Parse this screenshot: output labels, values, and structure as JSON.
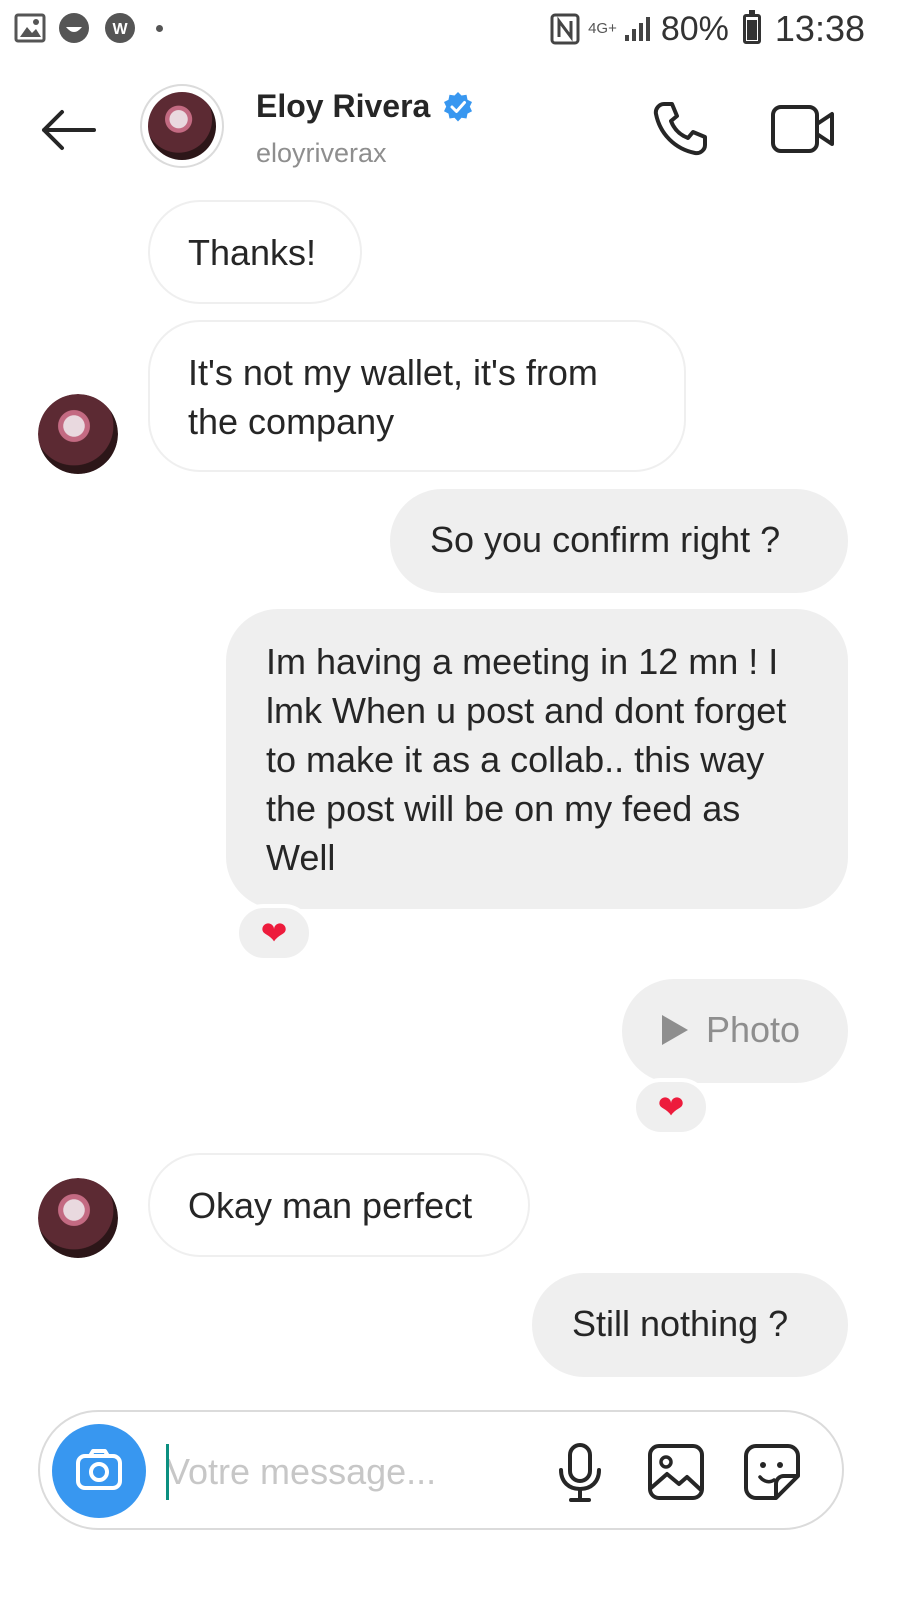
{
  "status_bar": {
    "left_icons": [
      "gallery-icon",
      "emoji-icon",
      "w-app-icon"
    ],
    "network": "4G+",
    "battery": "80%",
    "time": "13:38"
  },
  "header": {
    "name": "Eloy Rivera",
    "username": "eloyriverax",
    "verified": true
  },
  "messages": [
    {
      "direction": "in",
      "text": "Thanks!"
    },
    {
      "direction": "in",
      "text": "It's not my wallet, it's from the company"
    },
    {
      "direction": "out",
      "text": "So you confirm right ?"
    },
    {
      "direction": "out",
      "text": "Im having a meeting in 12 mn ! I lmk When u post and dont forget to make it as a collab.. this way the post will be on my feed as Well",
      "reaction": "❤"
    },
    {
      "direction": "out",
      "type": "photo",
      "text": "Photo",
      "reaction": "❤"
    },
    {
      "direction": "in",
      "text": "Okay man perfect"
    },
    {
      "direction": "out",
      "text": "Still nothing ?"
    }
  ],
  "composer": {
    "placeholder": "Votre message..."
  },
  "colors": {
    "accent": "#3897f0",
    "verified": "#3897f0",
    "outgoing_bubble": "#efefef",
    "heart": "#ed1b3c"
  }
}
